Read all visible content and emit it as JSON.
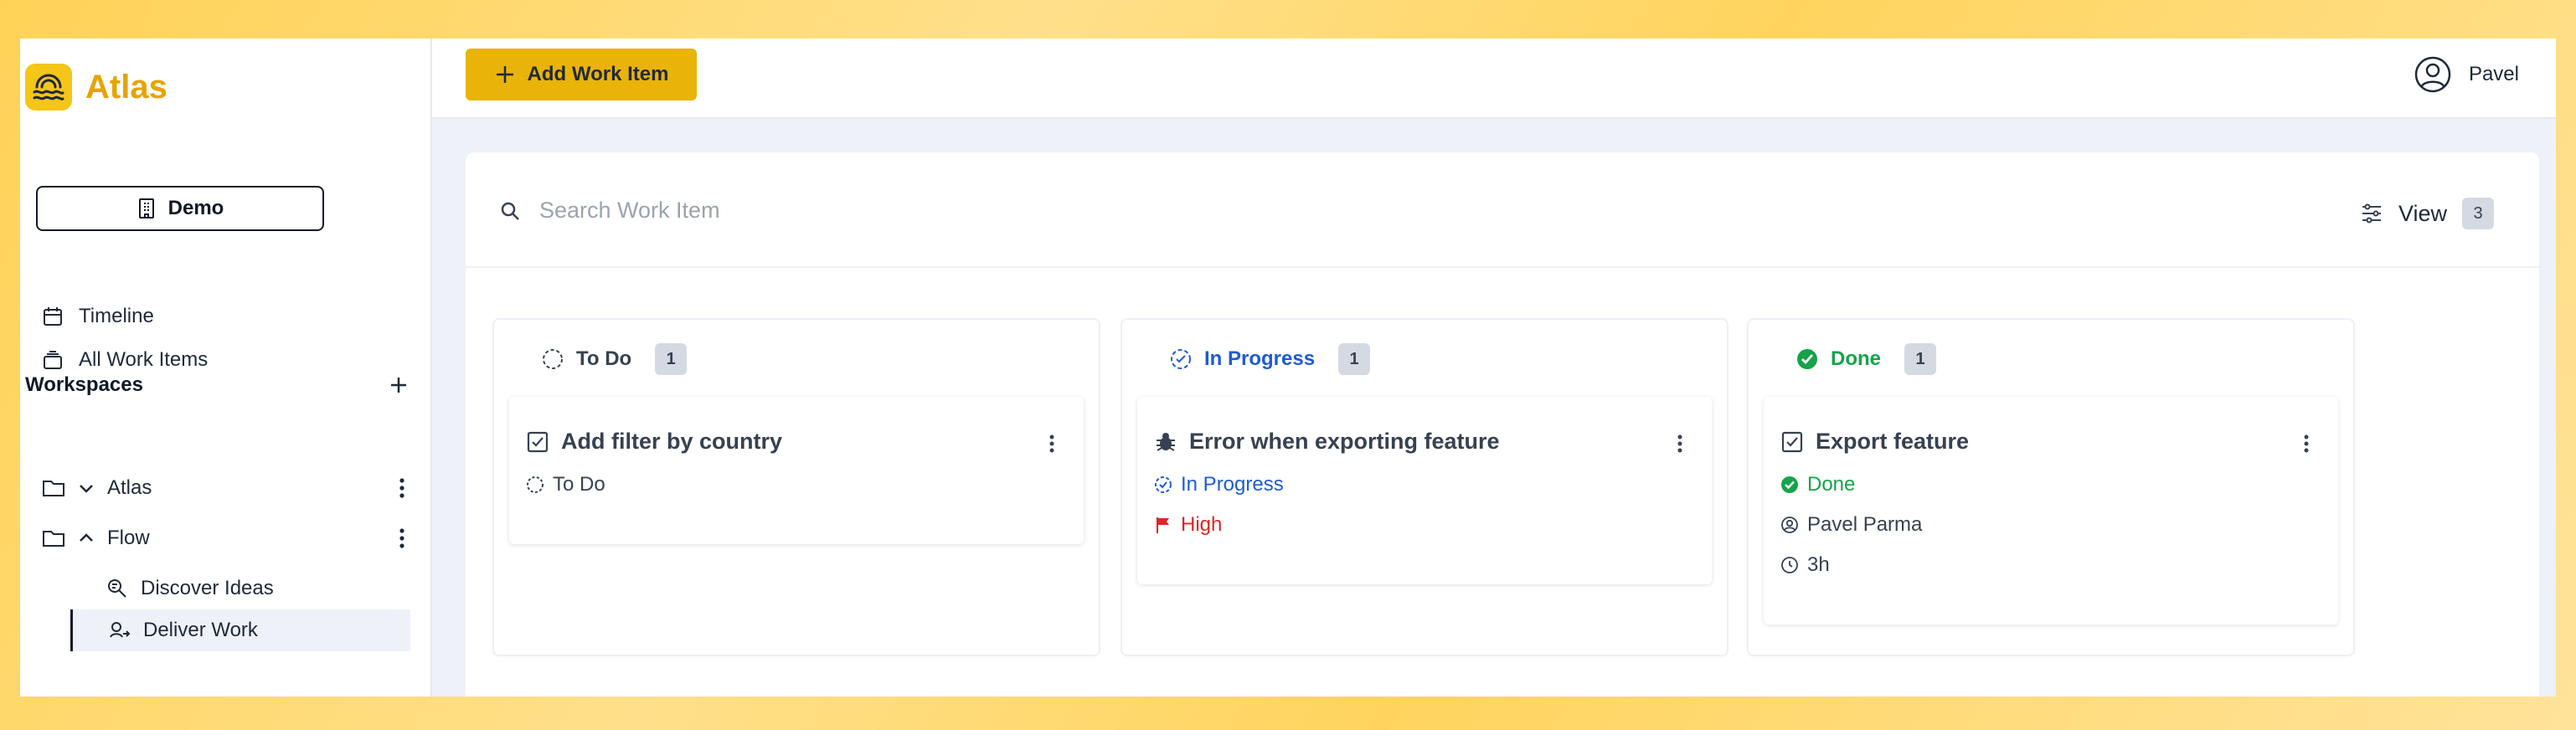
{
  "app": {
    "name": "Atlas"
  },
  "sidebar": {
    "org_button": "Demo",
    "nav": [
      {
        "label": "Timeline",
        "icon": "calendar-icon"
      },
      {
        "label": "All Work Items",
        "icon": "stack-icon"
      }
    ],
    "workspaces_label": "Workspaces",
    "workspaces": [
      {
        "label": "Atlas",
        "expanded": false
      },
      {
        "label": "Flow",
        "expanded": true,
        "children": [
          {
            "label": "Discover Ideas",
            "icon": "search-doc-icon"
          },
          {
            "label": "Deliver Work",
            "icon": "deliver-icon",
            "active": true
          }
        ]
      }
    ]
  },
  "topbar": {
    "add_button": "Add Work Item",
    "user_name": "Pavel"
  },
  "search": {
    "placeholder": "Search Work Item"
  },
  "view": {
    "label": "View",
    "count": "3"
  },
  "columns": [
    {
      "title": "To Do",
      "count": "1",
      "color": "#374151",
      "card": {
        "title": "Add filter by country",
        "type_icon": "checkbox-icon",
        "status": "To Do"
      }
    },
    {
      "title": "In Progress",
      "count": "1",
      "color": "#1d5bd6",
      "card": {
        "title": "Error when exporting feature",
        "type_icon": "bug-icon",
        "status": "In Progress",
        "priority": "High"
      }
    },
    {
      "title": "Done",
      "count": "1",
      "color": "#16a34a",
      "card": {
        "title": "Export feature",
        "type_icon": "checkbox-icon",
        "status": "Done",
        "assignee": "Pavel Parma",
        "estimate": "3h"
      }
    }
  ],
  "colors": {
    "accent": "#e9b308",
    "brand": "#e6a400",
    "in_progress": "#1d5bd6",
    "done": "#16a34a",
    "high": "#dc2626"
  }
}
